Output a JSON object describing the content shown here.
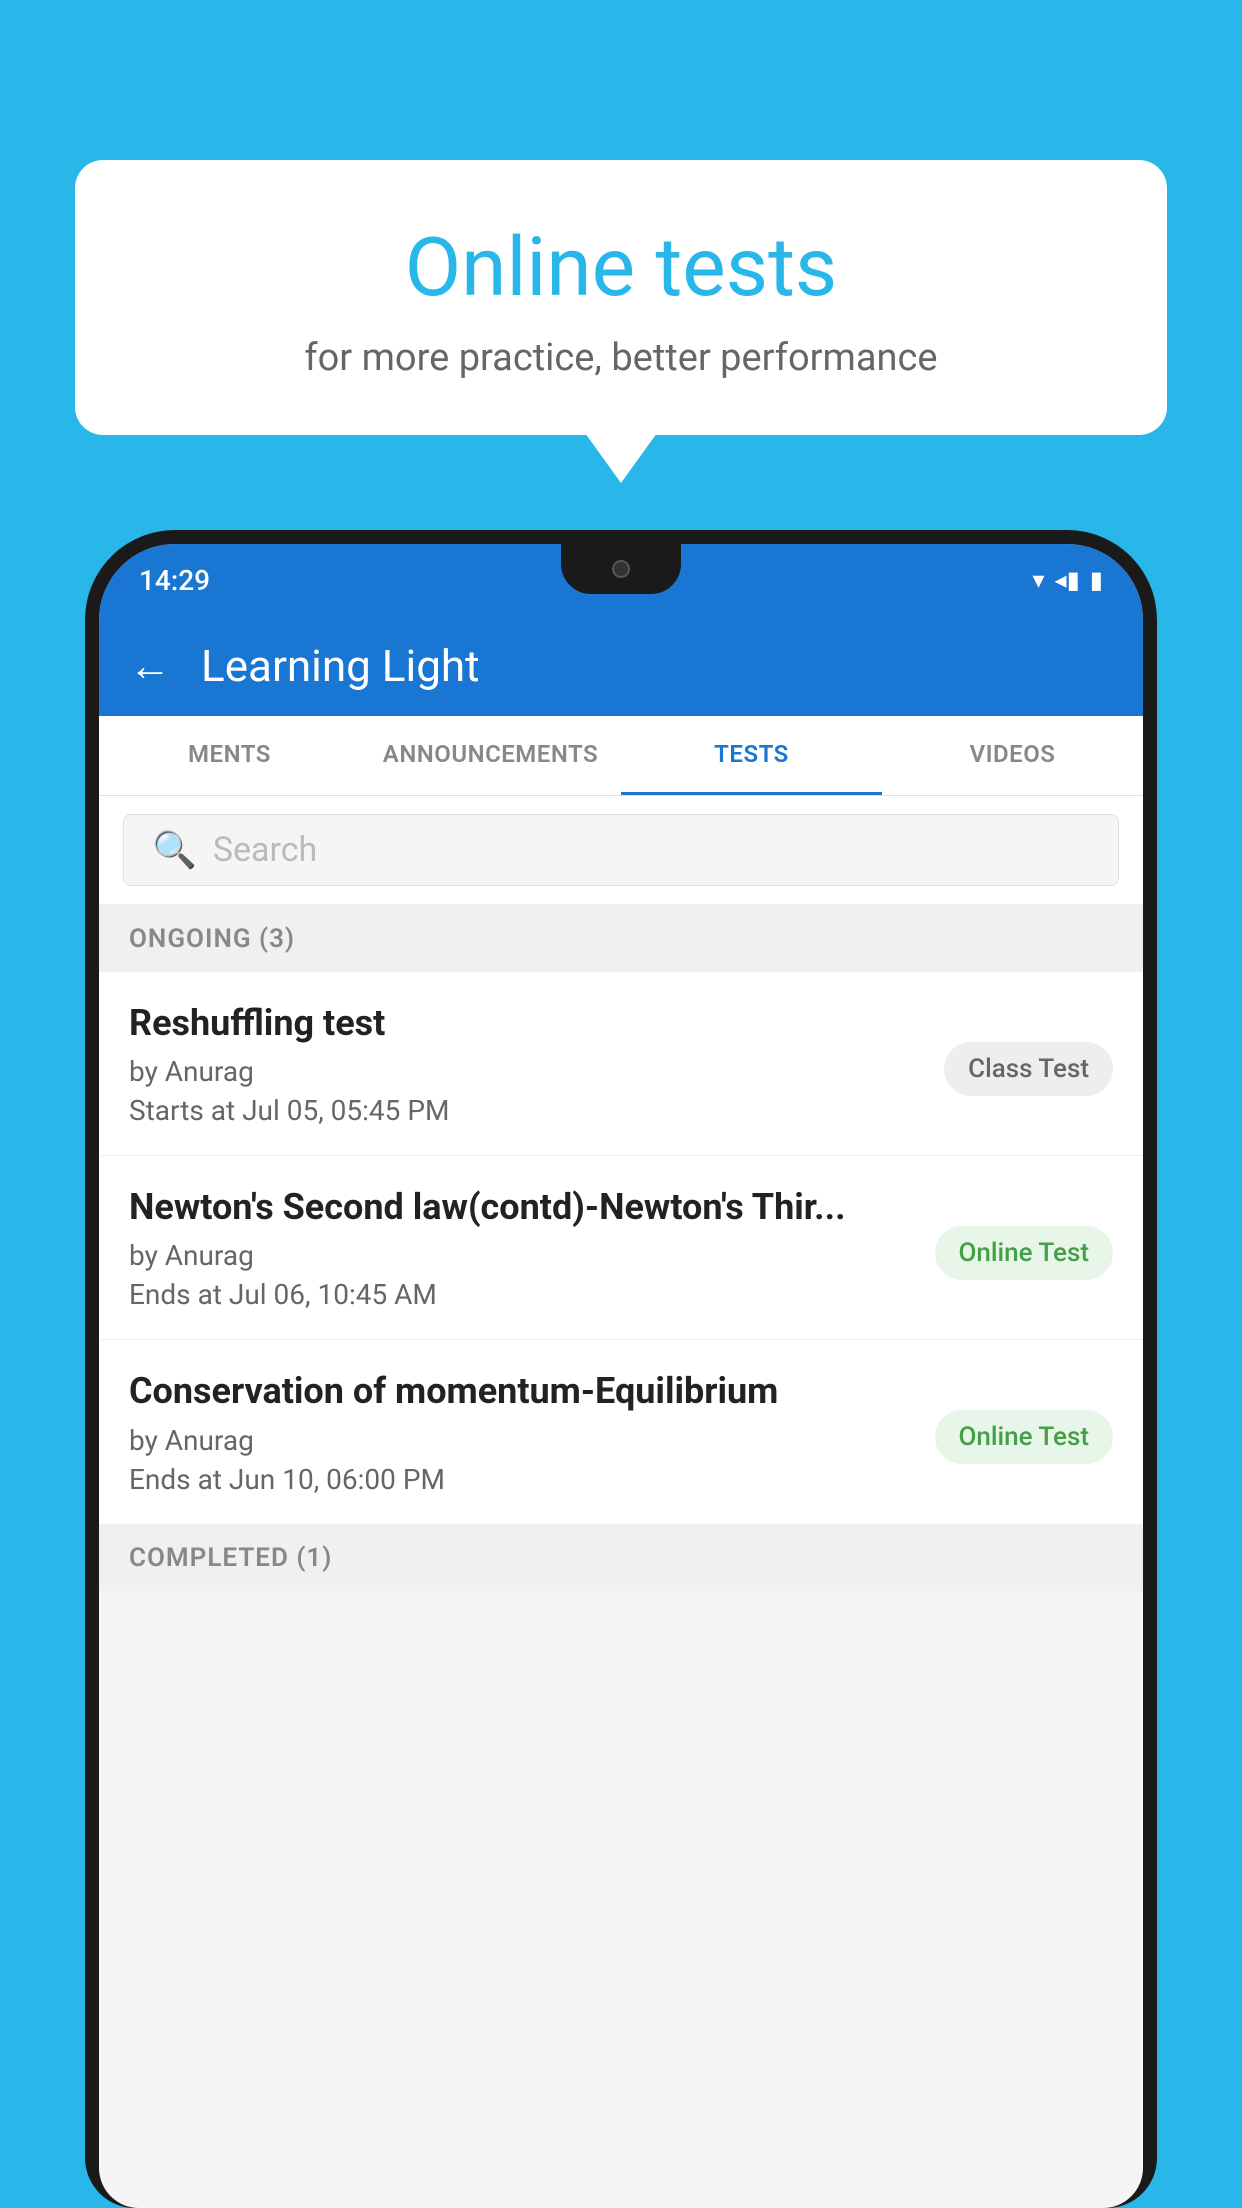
{
  "background_color": "#29b6e8",
  "bubble": {
    "title": "Online tests",
    "subtitle": "for more practice, better performance"
  },
  "phone": {
    "status_bar": {
      "time": "14:29",
      "icons": "▼◂▮"
    },
    "app_bar": {
      "back_label": "←",
      "title": "Learning Light"
    },
    "tabs": [
      {
        "label": "MENTS",
        "active": false
      },
      {
        "label": "ANNOUNCEMENTS",
        "active": false
      },
      {
        "label": "TESTS",
        "active": true
      },
      {
        "label": "VIDEOS",
        "active": false
      }
    ],
    "search": {
      "placeholder": "Search"
    },
    "ongoing_section": {
      "header": "ONGOING (3)",
      "items": [
        {
          "name": "Reshuffling test",
          "by": "by Anurag",
          "date_label": "Starts at",
          "date": "Jul 05, 05:45 PM",
          "badge": "Class Test",
          "badge_type": "class"
        },
        {
          "name": "Newton's Second law(contd)-Newton's Thir...",
          "by": "by Anurag",
          "date_label": "Ends at",
          "date": "Jul 06, 10:45 AM",
          "badge": "Online Test",
          "badge_type": "online"
        },
        {
          "name": "Conservation of momentum-Equilibrium",
          "by": "by Anurag",
          "date_label": "Ends at",
          "date": "Jun 10, 06:00 PM",
          "badge": "Online Test",
          "badge_type": "online"
        }
      ]
    },
    "completed_section": {
      "header": "COMPLETED (1)"
    }
  }
}
